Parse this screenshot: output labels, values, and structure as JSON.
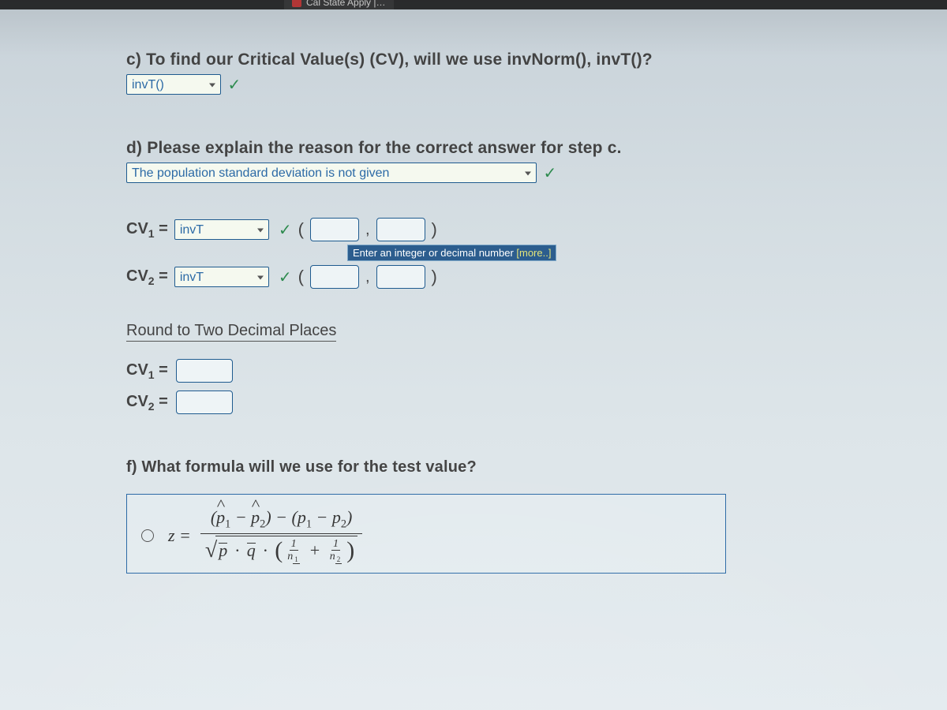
{
  "tab": {
    "label": "Cal State Apply |…"
  },
  "c": {
    "prompt": "c) To find our Critical Value(s) (CV), will we use invNorm(), invT()?",
    "select_value": "invT()"
  },
  "d": {
    "prompt": "d) Please explain the reason for the correct answer for step c.",
    "select_value": "The population standard deviation is not given"
  },
  "check_glyph": "✓",
  "cv_params": {
    "cv1_label_html": "CV<sub>1</sub> =",
    "cv2_label_html": "CV<sub>2</sub> =",
    "cv1_select": "invT",
    "cv2_select": "invT",
    "hint_main": "Enter an integer or decimal number ",
    "hint_more": "[more..]"
  },
  "round_header": "Round to Two Decimal Places",
  "cv_answers": {
    "cv1": "CV<sub>1</sub> =",
    "cv2": "CV<sub>2</sub> ="
  },
  "f": {
    "prompt": "f) What formula will we use for the test value?",
    "lhs": "z =",
    "num_parts": {
      "phat1": "p",
      "phat2": "p",
      "p1": "p",
      "p2": "p"
    },
    "den_parts": {
      "pbar": "p",
      "qbar": "q",
      "n1": "n",
      "n2": "n"
    }
  }
}
